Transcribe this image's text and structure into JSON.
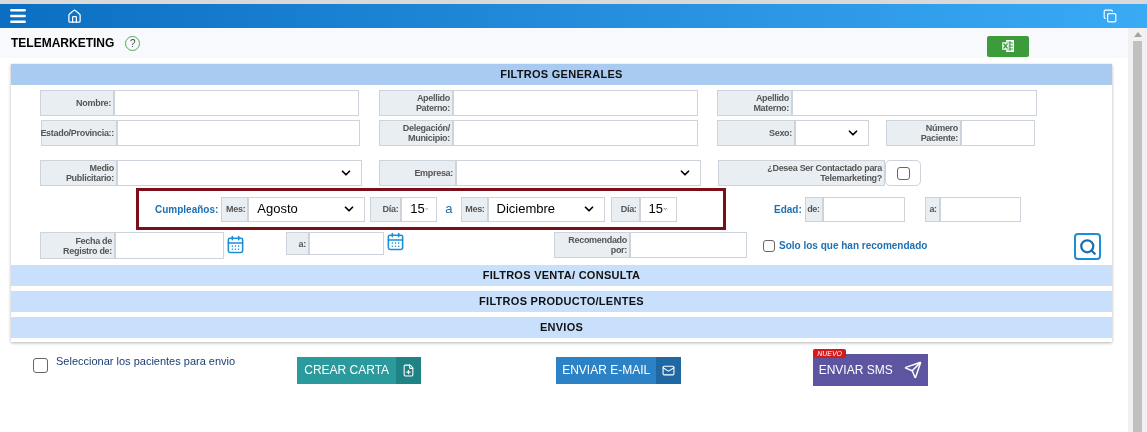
{
  "title": "TELEMARKETING",
  "help": "?",
  "sections": [
    {
      "title": "FILTROS GENERALES",
      "expanded": true
    },
    {
      "title": "FILTROS VENTA/ CONSULTA",
      "expanded": false
    },
    {
      "title": "FILTROS PRODUCTO/LENTES",
      "expanded": false
    },
    {
      "title": "ENVIOS",
      "expanded": false
    }
  ],
  "rows": [
    [
      {
        "kind": "text",
        "label": "Nombre:"
      },
      {
        "kind": "text",
        "label": "Apellido Paterno:"
      },
      {
        "kind": "text",
        "label": "Apellido Materno:"
      }
    ],
    [
      {
        "kind": "text",
        "label": "Estado/Provincia::"
      },
      {
        "kind": "text",
        "label": "Delegación/ Municipio:"
      },
      {
        "kind": "select",
        "label": "Sexo:"
      },
      {
        "kind": "text",
        "label": "Número Paciente:"
      }
    ],
    [
      {
        "kind": "select",
        "label": "Medio Publicitario:"
      },
      {
        "kind": "select",
        "label": "Empresa:"
      },
      {
        "kind": "checkbox",
        "label": "¿Desea Ser Contactado para Telemarketing?",
        "checked": false
      }
    ]
  ],
  "birthday": {
    "label": "Cumpleaños:",
    "separator": "a",
    "from": {
      "month_label": "Mes:",
      "month": "Agosto",
      "day_label": "Día:",
      "day": "15"
    },
    "to": {
      "month_label": "Mes:",
      "month": "Diciembre",
      "day_label": "Día:",
      "day": "15"
    }
  },
  "age": {
    "label": "Edad:",
    "from_label": "de:",
    "to_label": "a:"
  },
  "registration": {
    "from_label": "Fecha de Registro de:",
    "to_label": "a:"
  },
  "recommended": {
    "label": "Recomendado por:",
    "only_label": "Solo los que han recomendado",
    "only_checked": false
  },
  "select_patients": {
    "label": "Seleccionar los pacientes para envio",
    "checked": false
  },
  "actions": [
    {
      "kind": "letter",
      "label": "CREAR CARTA"
    },
    {
      "kind": "email",
      "label": "ENVIAR E-MAIL"
    },
    {
      "kind": "sms",
      "label": "ENVIAR SMS",
      "badge": "NUEVO"
    }
  ]
}
